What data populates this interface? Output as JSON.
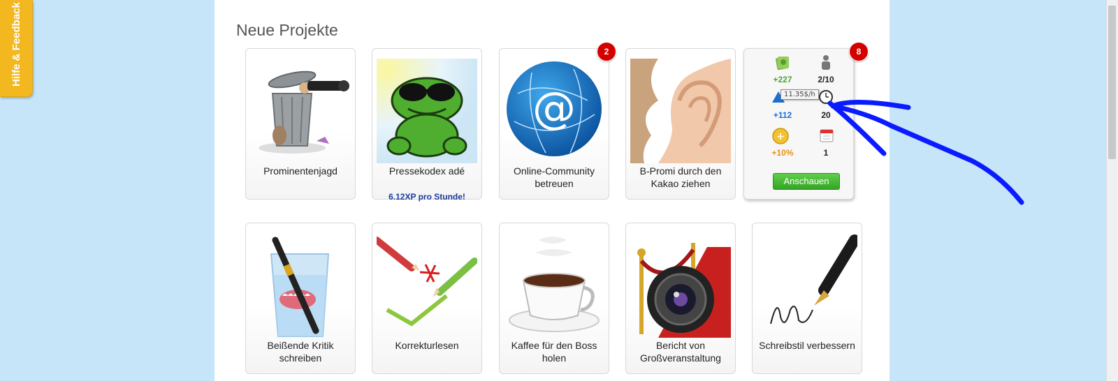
{
  "feedback_tab": {
    "label": "Hilfe & Feedback"
  },
  "section": {
    "title": "Neue Projekte"
  },
  "projects_row1": [
    {
      "name": "Prominentenjagd",
      "icon": "trashcan-paparazzi"
    },
    {
      "name": "Pressekodex adé",
      "icon": "frog-sunglasses",
      "xp": "6.12XP pro Stunde!"
    },
    {
      "name": "Online-Community betreuen",
      "icon": "globe-at",
      "badge": "2"
    },
    {
      "name": "B-Promi durch den Kakao ziehen",
      "icon": "ear-nose"
    }
  ],
  "detail_card": {
    "badge": "8",
    "money": "+227",
    "people": "2/10",
    "tooltip": "11.35$/h",
    "xp": "+112",
    "time": "20",
    "bonus": "+10%",
    "days": "1",
    "button": "Anschauen"
  },
  "projects_row2": [
    {
      "name": "Beißende Kritik schreiben",
      "icon": "teeth-glass-pen"
    },
    {
      "name": "Korrekturlesen",
      "icon": "pencils-check"
    },
    {
      "name": "Kaffee für den Boss holen",
      "icon": "coffee-cup"
    },
    {
      "name": "Bericht von Großveranstaltung",
      "icon": "camera-red-carpet"
    },
    {
      "name": "Schreibstil verbessern",
      "icon": "fountain-pen"
    }
  ],
  "colors": {
    "background": "#c6e5f9",
    "badge": "#d40000",
    "button": "#33a524",
    "scribble": "#0a1cff"
  }
}
